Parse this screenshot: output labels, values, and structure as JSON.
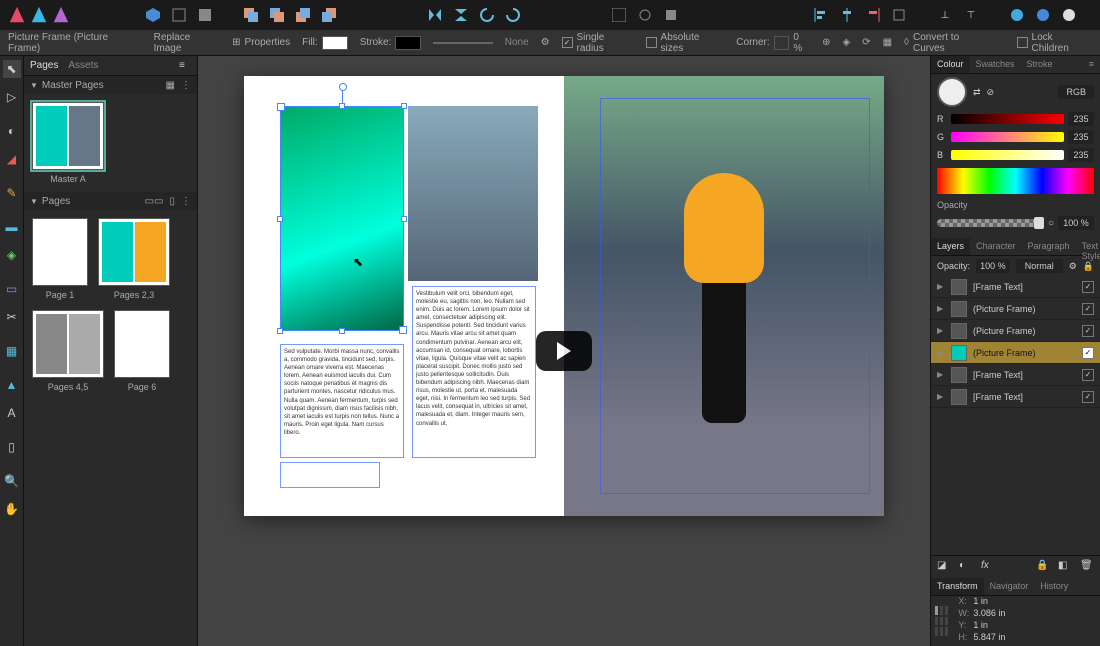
{
  "context": {
    "selection": "Picture Frame (Picture Frame)",
    "replace": "Replace Image",
    "properties": "Properties",
    "fill_label": "Fill:",
    "stroke_label": "Stroke:",
    "stroke_none": "None",
    "single_radius": "Single radius",
    "absolute_sizes": "Absolute sizes",
    "corner_label": "Corner:",
    "corner_value": "0 %",
    "convert": "Convert to Curves",
    "lock_children": "Lock Children"
  },
  "pages_panel": {
    "tab_pages": "Pages",
    "tab_assets": "Assets",
    "master_section": "Master Pages",
    "pages_section": "Pages",
    "master_a": "Master A",
    "thumbs": [
      {
        "label": "Page 1"
      },
      {
        "label": "Pages 2,3"
      },
      {
        "label": "Pages 4,5"
      },
      {
        "label": "Page 6"
      }
    ]
  },
  "canvas_text": {
    "tf1": "Sed vulputate. Morbi massa nunc, convallis a, commodo gravida, tincidunt sed, turpis. Aenean ornare viverra est. Maecenas lorem. Aenean euismod iaculis dui. Cum sociis natoque penatibus et magnis dis parturient montes, nascetur ridiculus mus. Nulla quam. Aenean fermentum, turpis sed volutpat dignissim, diam risus facilisis nibh, sit amet iaculis est turpis non tellus. Nunc a mauris. Proin eget ligula. Nam cursus libero.",
    "tf2": "Vestibulum velit orci, bibendum eget, molestie eu, sagittis non, leo. Nullam sed enim. Duis ac lorem. Lorem ipsum dolor sit amet, consectetuer adipiscing elit. Suspendisse potenti. Sed tincidunt varius arcu. Mauris vitae arcu sit amet quam condimentum pulvinar. Aenean arcu elit, accumsan id, consequat ornare, lobortis vitae, ligula. Quisque vitae velit ac sapien placerat suscipit. Donec mollis justo sed justo pellentesque sollicitudin. Duis bibendum adipiscing nibh. Maecenas diam risus, molestie ut, porta et, malesuada eget, nisi. In fermentum leo sed turpis. Sed lacus velit, consequat in, ultricies sit amet, malesuada et, diam. Integer mauris sem, convallis ut,"
  },
  "colour": {
    "tab_colour": "Colour",
    "tab_swatches": "Swatches",
    "tab_stroke": "Stroke",
    "mode": "RGB",
    "r": "R",
    "g": "G",
    "b": "B",
    "val": "235",
    "opacity_label": "Opacity",
    "opacity_value": "100 %"
  },
  "layers": {
    "tab_layers": "Layers",
    "tab_character": "Character",
    "tab_paragraph": "Paragraph",
    "tab_textstyles": "Text Styles",
    "opacity_label": "Opacity:",
    "opacity_value": "100 %",
    "blend_mode": "Normal",
    "items": [
      {
        "name": "[Frame Text]"
      },
      {
        "name": "(Picture Frame)"
      },
      {
        "name": "(Picture Frame)"
      },
      {
        "name": "(Picture Frame)"
      },
      {
        "name": "[Frame Text]"
      },
      {
        "name": "[Frame Text]"
      }
    ]
  },
  "transform": {
    "tab_transform": "Transform",
    "tab_navigator": "Navigator",
    "tab_history": "History",
    "x_label": "X:",
    "x_val": "1 in",
    "y_label": "Y:",
    "y_val": "1 in",
    "w_label": "W:",
    "w_val": "3.086 in",
    "h_label": "H:",
    "h_val": "5.847 in"
  }
}
